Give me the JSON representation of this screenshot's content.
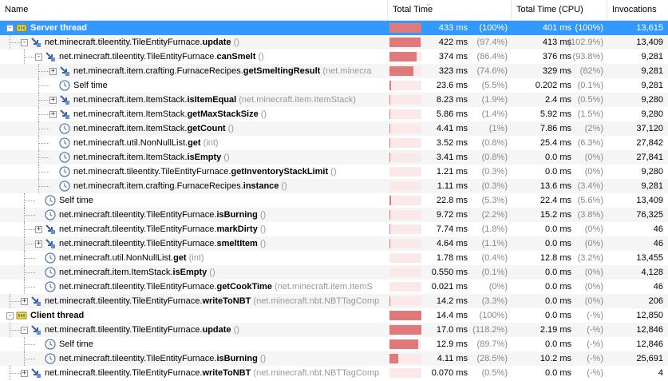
{
  "columns": {
    "name": "Name",
    "total_time": "Total Time",
    "total_time_cpu": "Total Time (CPU)",
    "invocations": "Invocations"
  },
  "rows": [
    {
      "name": "Server thread",
      "bold": "",
      "sig": "",
      "depth": 0,
      "exp": "-",
      "icon": "thread",
      "tt": "433 ms",
      "ttp": "(100%)",
      "bar": 100,
      "cpu": "401 ms",
      "cpup": "(100%)",
      "inv": "13,615",
      "sel": true
    },
    {
      "name": "net.minecraft.tileentity.TileEntityFurnace.",
      "bold": "update",
      "sig": " ()",
      "depth": 1,
      "exp": "-",
      "icon": "method",
      "tt": "422 ms",
      "ttp": "(97.4%)",
      "bar": 97,
      "cpu": "413 ms",
      "cpup": "(102.9%)",
      "inv": "13,409"
    },
    {
      "name": "net.minecraft.tileentity.TileEntityFurnace.",
      "bold": "canSmelt",
      "sig": " ()",
      "depth": 2,
      "exp": "-",
      "icon": "method",
      "tt": "374 ms",
      "ttp": "(86.4%)",
      "bar": 86,
      "cpu": "376 ms",
      "cpup": "(93.8%)",
      "inv": "9,281"
    },
    {
      "name": "net.minecraft.item.crafting.FurnaceRecipes.",
      "bold": "getSmeltingResult",
      "sig": " (net.minecra",
      "depth": 3,
      "exp": "+",
      "icon": "method",
      "tt": "323 ms",
      "ttp": "(74.6%)",
      "bar": 75,
      "cpu": "329 ms",
      "cpup": "(82%)",
      "inv": "9,281"
    },
    {
      "name": "Self time",
      "bold": "",
      "sig": "",
      "depth": 3,
      "exp": "",
      "icon": "clock",
      "tt": "23.6 ms",
      "ttp": "(5.5%)",
      "bar": 5,
      "cpu": "0.202 ms",
      "cpup": "(0.1%)",
      "inv": "9,281"
    },
    {
      "name": "net.minecraft.item.ItemStack.",
      "bold": "isItemEqual",
      "sig": " (net.minecraft.item.ItemStack)",
      "depth": 3,
      "exp": "+",
      "icon": "method",
      "tt": "8.23 ms",
      "ttp": "(1.9%)",
      "bar": 2,
      "cpu": "2.4 ms",
      "cpup": "(0.5%)",
      "inv": "9,280"
    },
    {
      "name": "net.minecraft.item.ItemStack.",
      "bold": "getMaxStackSize",
      "sig": " ()",
      "depth": 3,
      "exp": "+",
      "icon": "method",
      "tt": "5.86 ms",
      "ttp": "(1.4%)",
      "bar": 1,
      "cpu": "5.92 ms",
      "cpup": "(1.5%)",
      "inv": "9,280"
    },
    {
      "name": "net.minecraft.item.ItemStack.",
      "bold": "getCount",
      "sig": " ()",
      "depth": 3,
      "exp": "",
      "icon": "clock",
      "tt": "4.41 ms",
      "ttp": "(1%)",
      "bar": 1,
      "cpu": "7.86 ms",
      "cpup": "(2%)",
      "inv": "37,120"
    },
    {
      "name": "net.minecraft.util.NonNullList.",
      "bold": "get",
      "sig": " (int)",
      "depth": 3,
      "exp": "",
      "icon": "clock",
      "tt": "3.52 ms",
      "ttp": "(0.8%)",
      "bar": 1,
      "cpu": "25.4 ms",
      "cpup": "(6.3%)",
      "inv": "27,842"
    },
    {
      "name": "net.minecraft.item.ItemStack.",
      "bold": "isEmpty",
      "sig": " ()",
      "depth": 3,
      "exp": "",
      "icon": "clock",
      "tt": "3.41 ms",
      "ttp": "(0.8%)",
      "bar": 1,
      "cpu": "0.0 ms",
      "cpup": "(0%)",
      "inv": "27,841"
    },
    {
      "name": "net.minecraft.tileentity.TileEntityFurnace.",
      "bold": "getInventoryStackLimit",
      "sig": " ()",
      "depth": 3,
      "exp": "",
      "icon": "clock",
      "tt": "1.21 ms",
      "ttp": "(0.3%)",
      "bar": 0,
      "cpu": "0.0 ms",
      "cpup": "(0%)",
      "inv": "9,280"
    },
    {
      "name": "net.minecraft.item.crafting.FurnaceRecipes.",
      "bold": "instance",
      "sig": " ()",
      "depth": 3,
      "exp": "",
      "icon": "clock",
      "tt": "1.11 ms",
      "ttp": "(0.3%)",
      "bar": 0,
      "cpu": "13.6 ms",
      "cpup": "(3.4%)",
      "inv": "9,281"
    },
    {
      "name": "Self time",
      "bold": "",
      "sig": "",
      "depth": 2,
      "exp": "",
      "icon": "clock",
      "tt": "22.8 ms",
      "ttp": "(5.3%)",
      "bar": 5,
      "cpu": "22.4 ms",
      "cpup": "(5.6%)",
      "inv": "13,409"
    },
    {
      "name": "net.minecraft.tileentity.TileEntityFurnace.",
      "bold": "isBurning",
      "sig": " ()",
      "depth": 2,
      "exp": "",
      "icon": "clock",
      "tt": "9.72 ms",
      "ttp": "(2.2%)",
      "bar": 2,
      "cpu": "15.2 ms",
      "cpup": "(3.8%)",
      "inv": "76,325"
    },
    {
      "name": "net.minecraft.tileentity.TileEntityFurnace.",
      "bold": "markDirty",
      "sig": " ()",
      "depth": 2,
      "exp": "+",
      "icon": "method",
      "tt": "7.74 ms",
      "ttp": "(1.8%)",
      "bar": 2,
      "cpu": "0.0 ms",
      "cpup": "(0%)",
      "inv": "46"
    },
    {
      "name": "net.minecraft.tileentity.TileEntityFurnace.",
      "bold": "smeltItem",
      "sig": " ()",
      "depth": 2,
      "exp": "+",
      "icon": "method",
      "tt": "4.64 ms",
      "ttp": "(1.1%)",
      "bar": 1,
      "cpu": "0.0 ms",
      "cpup": "(0%)",
      "inv": "46"
    },
    {
      "name": "net.minecraft.util.NonNullList.",
      "bold": "get",
      "sig": " (int)",
      "depth": 2,
      "exp": "",
      "icon": "clock",
      "tt": "1.78 ms",
      "ttp": "(0.4%)",
      "bar": 0,
      "cpu": "12.8 ms",
      "cpup": "(3.2%)",
      "inv": "13,455"
    },
    {
      "name": "net.minecraft.item.ItemStack.",
      "bold": "isEmpty",
      "sig": " ()",
      "depth": 2,
      "exp": "",
      "icon": "clock",
      "tt": "0.550 ms",
      "ttp": "(0.1%)",
      "bar": 0,
      "cpu": "0.0 ms",
      "cpup": "(0%)",
      "inv": "4,128"
    },
    {
      "name": "net.minecraft.tileentity.TileEntityFurnace.",
      "bold": "getCookTime",
      "sig": " (net.minecraft.item.ItemS",
      "depth": 2,
      "exp": "",
      "icon": "clock",
      "tt": "0.021 ms",
      "ttp": "(0%)",
      "bar": 0,
      "cpu": "0.0 ms",
      "cpup": "(0%)",
      "inv": "46"
    },
    {
      "name": "net.minecraft.tileentity.TileEntityFurnace.",
      "bold": "writeToNBT",
      "sig": " (net.minecraft.nbt.NBTTagComp",
      "depth": 1,
      "exp": "+",
      "icon": "method",
      "tt": "14.2 ms",
      "ttp": "(3.3%)",
      "bar": 3,
      "cpu": "0.0 ms",
      "cpup": "(0%)",
      "inv": "206"
    },
    {
      "name": "Client thread",
      "bold": "",
      "sig": "",
      "depth": 0,
      "exp": "-",
      "icon": "thread",
      "tt": "14.4 ms",
      "ttp": "(100%)",
      "bar": 100,
      "cpu": "0.0 ms",
      "cpup": "(-%)",
      "inv": "12,850",
      "bold_whole": true
    },
    {
      "name": "net.minecraft.tileentity.TileEntityFurnace.",
      "bold": "update",
      "sig": " ()",
      "depth": 1,
      "exp": "-",
      "icon": "method",
      "tt": "17.0 ms",
      "ttp": "(118.2%)",
      "bar": 100,
      "cpu": "2.19 ms",
      "cpup": "(-%)",
      "inv": "12,846"
    },
    {
      "name": "Self time",
      "bold": "",
      "sig": "",
      "depth": 2,
      "exp": "",
      "icon": "clock",
      "tt": "12.9 ms",
      "ttp": "(89.7%)",
      "bar": 90,
      "cpu": "0.0 ms",
      "cpup": "(-%)",
      "inv": "12,846"
    },
    {
      "name": "net.minecraft.tileentity.TileEntityFurnace.",
      "bold": "isBurning",
      "sig": " ()",
      "depth": 2,
      "exp": "",
      "icon": "clock",
      "tt": "4.11 ms",
      "ttp": "(28.5%)",
      "bar": 28,
      "cpu": "10.2 ms",
      "cpup": "(-%)",
      "inv": "25,691"
    },
    {
      "name": "net.minecraft.tileentity.TileEntityFurnace.",
      "bold": "writeToNBT",
      "sig": " (net.minecraft.nbt.NBTTagComp",
      "depth": 1,
      "exp": "+",
      "icon": "method",
      "tt": "0.070 ms",
      "ttp": "(0.5%)",
      "bar": 0,
      "cpu": "0.0 ms",
      "cpup": "(-%)",
      "inv": "4"
    }
  ]
}
